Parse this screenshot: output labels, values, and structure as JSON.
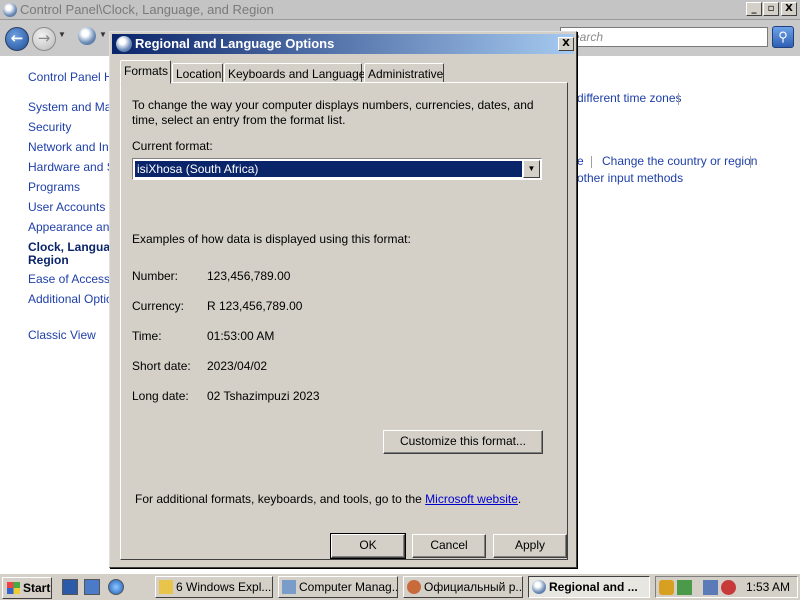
{
  "background_window": {
    "title": "Control Panel\\Clock, Language, and Region",
    "controls": [
      "_",
      "▫",
      "X"
    ],
    "search_placeholder": "Search",
    "sidebar": [
      "Control Panel Home",
      "System and Maintenance",
      "Security",
      "Network and Internet",
      "Hardware and Sound",
      "Programs",
      "User Accounts",
      "Appearance and Personalization",
      "Clock, Language, and",
      "Region",
      "Ease of Access",
      "Additional Options",
      "Classic View"
    ],
    "main_links": {
      "time_zones": "different time zones",
      "partial_e": "e",
      "change_country": "Change the country or region",
      "input_methods": "other input methods"
    }
  },
  "dialog": {
    "title": "Regional and Language Options",
    "close": "X",
    "tabs": [
      "Formats",
      "Location",
      "Keyboards and Languages",
      "Administrative"
    ],
    "intro_line1": "To change the way your computer displays numbers, currencies, dates, and",
    "intro_line2": "time, select an entry from the format list.",
    "current_format_label": "Current format:",
    "current_format_value": "isiXhosa (South Africa)",
    "examples_heading": "Examples of how data is displayed using this format:",
    "examples": [
      {
        "label": "Number:",
        "value": "123,456,789.00"
      },
      {
        "label": "Currency:",
        "value": "R 123,456,789.00"
      },
      {
        "label": "Time:",
        "value": "01:53:00 AM"
      },
      {
        "label": "Short date:",
        "value": "2023/04/02"
      },
      {
        "label": "Long date:",
        "value": "02 Tshazimpuzi 2023"
      }
    ],
    "customize_button": "Customize this format...",
    "footer_text": "For additional formats, keyboards, and tools, go to the ",
    "footer_link": "Microsoft website",
    "footer_end": ".",
    "ok": "OK",
    "cancel": "Cancel",
    "apply": "Apply"
  },
  "taskbar": {
    "start": "Start",
    "tasks": [
      {
        "label": "6 Windows Expl...",
        "count": "6"
      },
      {
        "label": "Computer Manag..."
      },
      {
        "label": "Официальный р..."
      },
      {
        "label": "Regional and ..."
      }
    ],
    "clock": "1:53 AM"
  }
}
